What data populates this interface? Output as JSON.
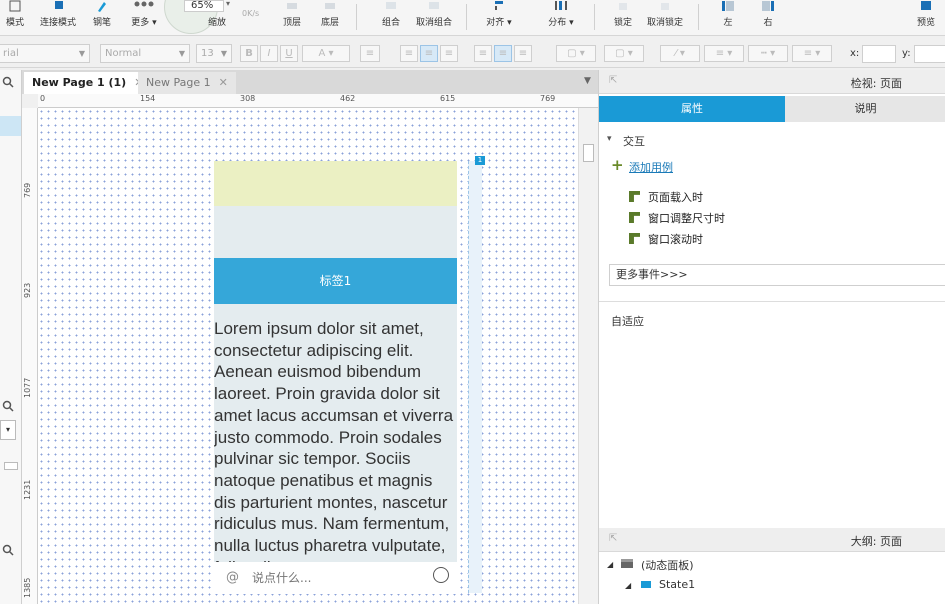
{
  "toolbar": {
    "items": [
      {
        "label": "模式"
      },
      {
        "label": "连接模式"
      },
      {
        "label": "钢笔"
      },
      {
        "label": "更多 ▾"
      },
      {
        "label": "缩放"
      },
      {
        "label": "顶层"
      },
      {
        "label": "底层"
      },
      {
        "label": "组合"
      },
      {
        "label": "取消组合"
      },
      {
        "label": "对齐 ▾"
      },
      {
        "label": "分布 ▾"
      },
      {
        "label": "锁定"
      },
      {
        "label": "取消锁定"
      },
      {
        "label": "左"
      },
      {
        "label": "右"
      },
      {
        "label": "预览"
      }
    ],
    "zoom_value": "65%",
    "speed": "0K/s"
  },
  "format": {
    "font_family": "rial",
    "font_style": "Normal",
    "font_size": "13",
    "x_label": "x:",
    "y_label": "y:"
  },
  "tabs": [
    {
      "label": "New Page 1 (1)"
    },
    {
      "label": "New Page 1"
    }
  ],
  "ruler": {
    "h": [
      "0",
      "154",
      "308",
      "462",
      "615",
      "769"
    ],
    "v": [
      "769",
      "923",
      "1077",
      "1231",
      "1385"
    ]
  },
  "canvas": {
    "tab_label": "标签1",
    "lorem": "Lorem ipsum dolor sit amet, consectetur adipiscing elit. Aenean euismod bibendum laoreet. Proin gravida dolor sit amet lacus accumsan et viverra justo commodo. Proin sodales pulvinar sic tempor. Sociis natoque penatibus et magnis dis parturient montes, nascetur ridiculus mus. Nam fermentum, nulla luctus pharetra vulputate, felis tellus",
    "chat_at": "@",
    "chat_placeholder": "说点什么...",
    "marker": "1"
  },
  "inspector": {
    "title": "检视: 页面",
    "tab_props": "属性",
    "tab_notes": "说明",
    "section_interaction": "交互",
    "add_case": "添加用例",
    "events": [
      "页面载入时",
      "窗口调整尺寸时",
      "窗口滚动时"
    ],
    "more_events": "更多事件>>>",
    "adaptive": "自适应"
  },
  "outline": {
    "title": "大纲: 页面",
    "items": [
      "(动态面板)",
      "State1"
    ]
  },
  "colors": {
    "accent": "#1a9ad6",
    "tab_blue": "#35a7d9",
    "yellow_block": "#ebf0c3",
    "gray_block": "#e4ecef"
  }
}
